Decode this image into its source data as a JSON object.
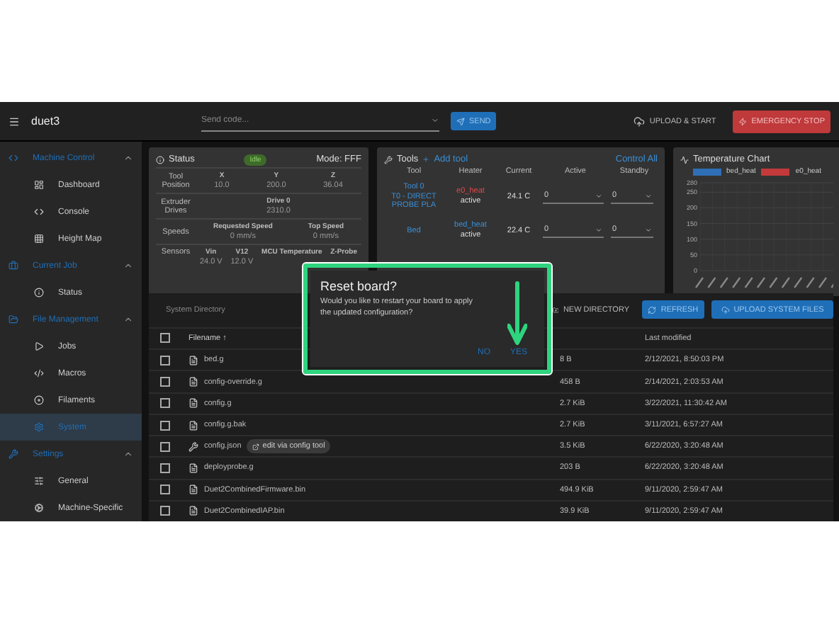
{
  "top_bar": {
    "title": "duet3",
    "send_code": {
      "placeholder": "Send code..."
    },
    "send_button": "SEND",
    "upload_button": "UPLOAD & START",
    "emergency_button": "EMERGENCY STOP"
  },
  "sidebar": {
    "items": [
      {
        "kind": "section",
        "label": "Machine Control",
        "expanded": true
      },
      {
        "kind": "item",
        "label": "Dashboard",
        "selected": false
      },
      {
        "kind": "item",
        "label": "Console",
        "selected": false
      },
      {
        "kind": "item",
        "label": "Height Map",
        "selected": false
      },
      {
        "kind": "section",
        "label": "Current Job",
        "expanded": true
      },
      {
        "kind": "item",
        "label": "Status",
        "selected": false
      },
      {
        "kind": "section",
        "label": "File Management",
        "expanded": true
      },
      {
        "kind": "item",
        "label": "Jobs",
        "selected": false
      },
      {
        "kind": "item",
        "label": "Macros",
        "selected": false
      },
      {
        "kind": "item",
        "label": "Filaments",
        "selected": false
      },
      {
        "kind": "item",
        "label": "System",
        "selected": true
      },
      {
        "kind": "section",
        "label": "Settings",
        "expanded": true
      },
      {
        "kind": "item",
        "label": "General",
        "selected": false
      },
      {
        "kind": "item",
        "label": "Machine-Specific",
        "selected": false
      }
    ]
  },
  "status": {
    "title": "Status",
    "state": "Idle",
    "mode": "Mode: FFF",
    "groups": [
      {
        "label": "Tool Position",
        "readings": [
          {
            "name": "X",
            "value": "10.0"
          },
          {
            "name": "Y",
            "value": "200.0"
          },
          {
            "name": "Z",
            "value": "36.04"
          }
        ]
      },
      {
        "label": "Extruder Drives",
        "readings": [
          {
            "name": "Drive 0",
            "value": "2310.0"
          }
        ]
      },
      {
        "label": "Speeds",
        "readings": [
          {
            "name": "Requested Speed",
            "value": "0 mm/s"
          },
          {
            "name": "Top Speed",
            "value": "0 mm/s"
          }
        ]
      },
      {
        "label": "Sensors",
        "readings": [
          {
            "name": "Vin",
            "value": "24.0 V"
          },
          {
            "name": "V12",
            "value": "12.0 V"
          },
          {
            "name": "MCU Temperature"
          },
          {
            "name": "Z-Probe"
          }
        ]
      }
    ]
  },
  "tools": {
    "title": "Tools",
    "add_link": "Add tool",
    "control_all": "Control All",
    "columns": [
      "Tool",
      "Heater",
      "Current",
      "Active",
      "Standby"
    ],
    "rows": [
      {
        "tool": "Tool 0",
        "tool_detail": "T0 - DIRECT PROBE PLA",
        "heater": "e0_heat",
        "color": "#e04848",
        "heater_state": "active",
        "current": "24.1 C",
        "active": "0",
        "standby": "0"
      },
      {
        "tool": "Bed",
        "heater": "bed_heat",
        "color": "#3a8fd8",
        "heater_state": "active",
        "current": "22.4 C",
        "active": "0",
        "standby": "0"
      }
    ]
  },
  "temperature_chart": {
    "title": "Temperature Chart",
    "chart_data": {
      "type": "line",
      "grid": true,
      "ylim": [
        0,
        280
      ],
      "yticks": [
        0,
        50,
        100,
        150,
        200,
        250,
        280
      ],
      "series": [
        {
          "name": "bed_heat",
          "color": "#2f6fb5",
          "values": [
            null
          ]
        },
        {
          "name": "e0_heat",
          "color": "#c43a3a",
          "values": [
            null
          ]
        }
      ]
    }
  },
  "files": {
    "directory": "System Directory",
    "buttons": [
      {
        "kind": "plain",
        "label": "NEW DIRECTORY"
      },
      {
        "kind": "primary",
        "label": "REFRESH"
      },
      {
        "kind": "primary",
        "label": "UPLOAD SYSTEM FILES"
      }
    ],
    "columns": {
      "all_checked": false,
      "filename": "Filename ↑",
      "modified": "Last modified"
    },
    "rows": [
      {
        "kind": "file",
        "name": "bed.g",
        "size": "8 B",
        "modified": "2/12/2021, 8:50:03 PM",
        "checked": false
      },
      {
        "kind": "file",
        "name": "config-override.g",
        "size": "458 B",
        "modified": "2/14/2021, 2:03:53 AM",
        "checked": false
      },
      {
        "kind": "file",
        "name": "config.g",
        "size": "2.7 KiB",
        "modified": "3/22/2021, 11:30:42 AM",
        "checked": false
      },
      {
        "kind": "file",
        "name": "config.g.bak",
        "size": "2.7 KiB",
        "modified": "3/11/2021, 6:57:27 AM",
        "checked": false
      },
      {
        "kind": "tool",
        "name": "config.json",
        "chip": "edit via config tool",
        "size": "3.5 KiB",
        "modified": "6/22/2020, 3:20:48 AM",
        "checked": false
      },
      {
        "kind": "file",
        "name": "deployprobe.g",
        "size": "203 B",
        "modified": "6/22/2020, 3:20:48 AM",
        "checked": false
      },
      {
        "kind": "file",
        "name": "Duet2CombinedFirmware.bin",
        "size": "494.9 KiB",
        "modified": "9/11/2020, 2:59:47 AM",
        "checked": false
      },
      {
        "kind": "file",
        "name": "Duet2CombinedIAP.bin",
        "size": "39.9 KiB",
        "modified": "9/11/2020, 2:59:47 AM",
        "checked": false
      }
    ]
  },
  "dialog": {
    "title": "Reset board?",
    "message": "Would you like to restart your board to apply the updated configuration?",
    "buttons": [
      "NO",
      "YES"
    ]
  }
}
